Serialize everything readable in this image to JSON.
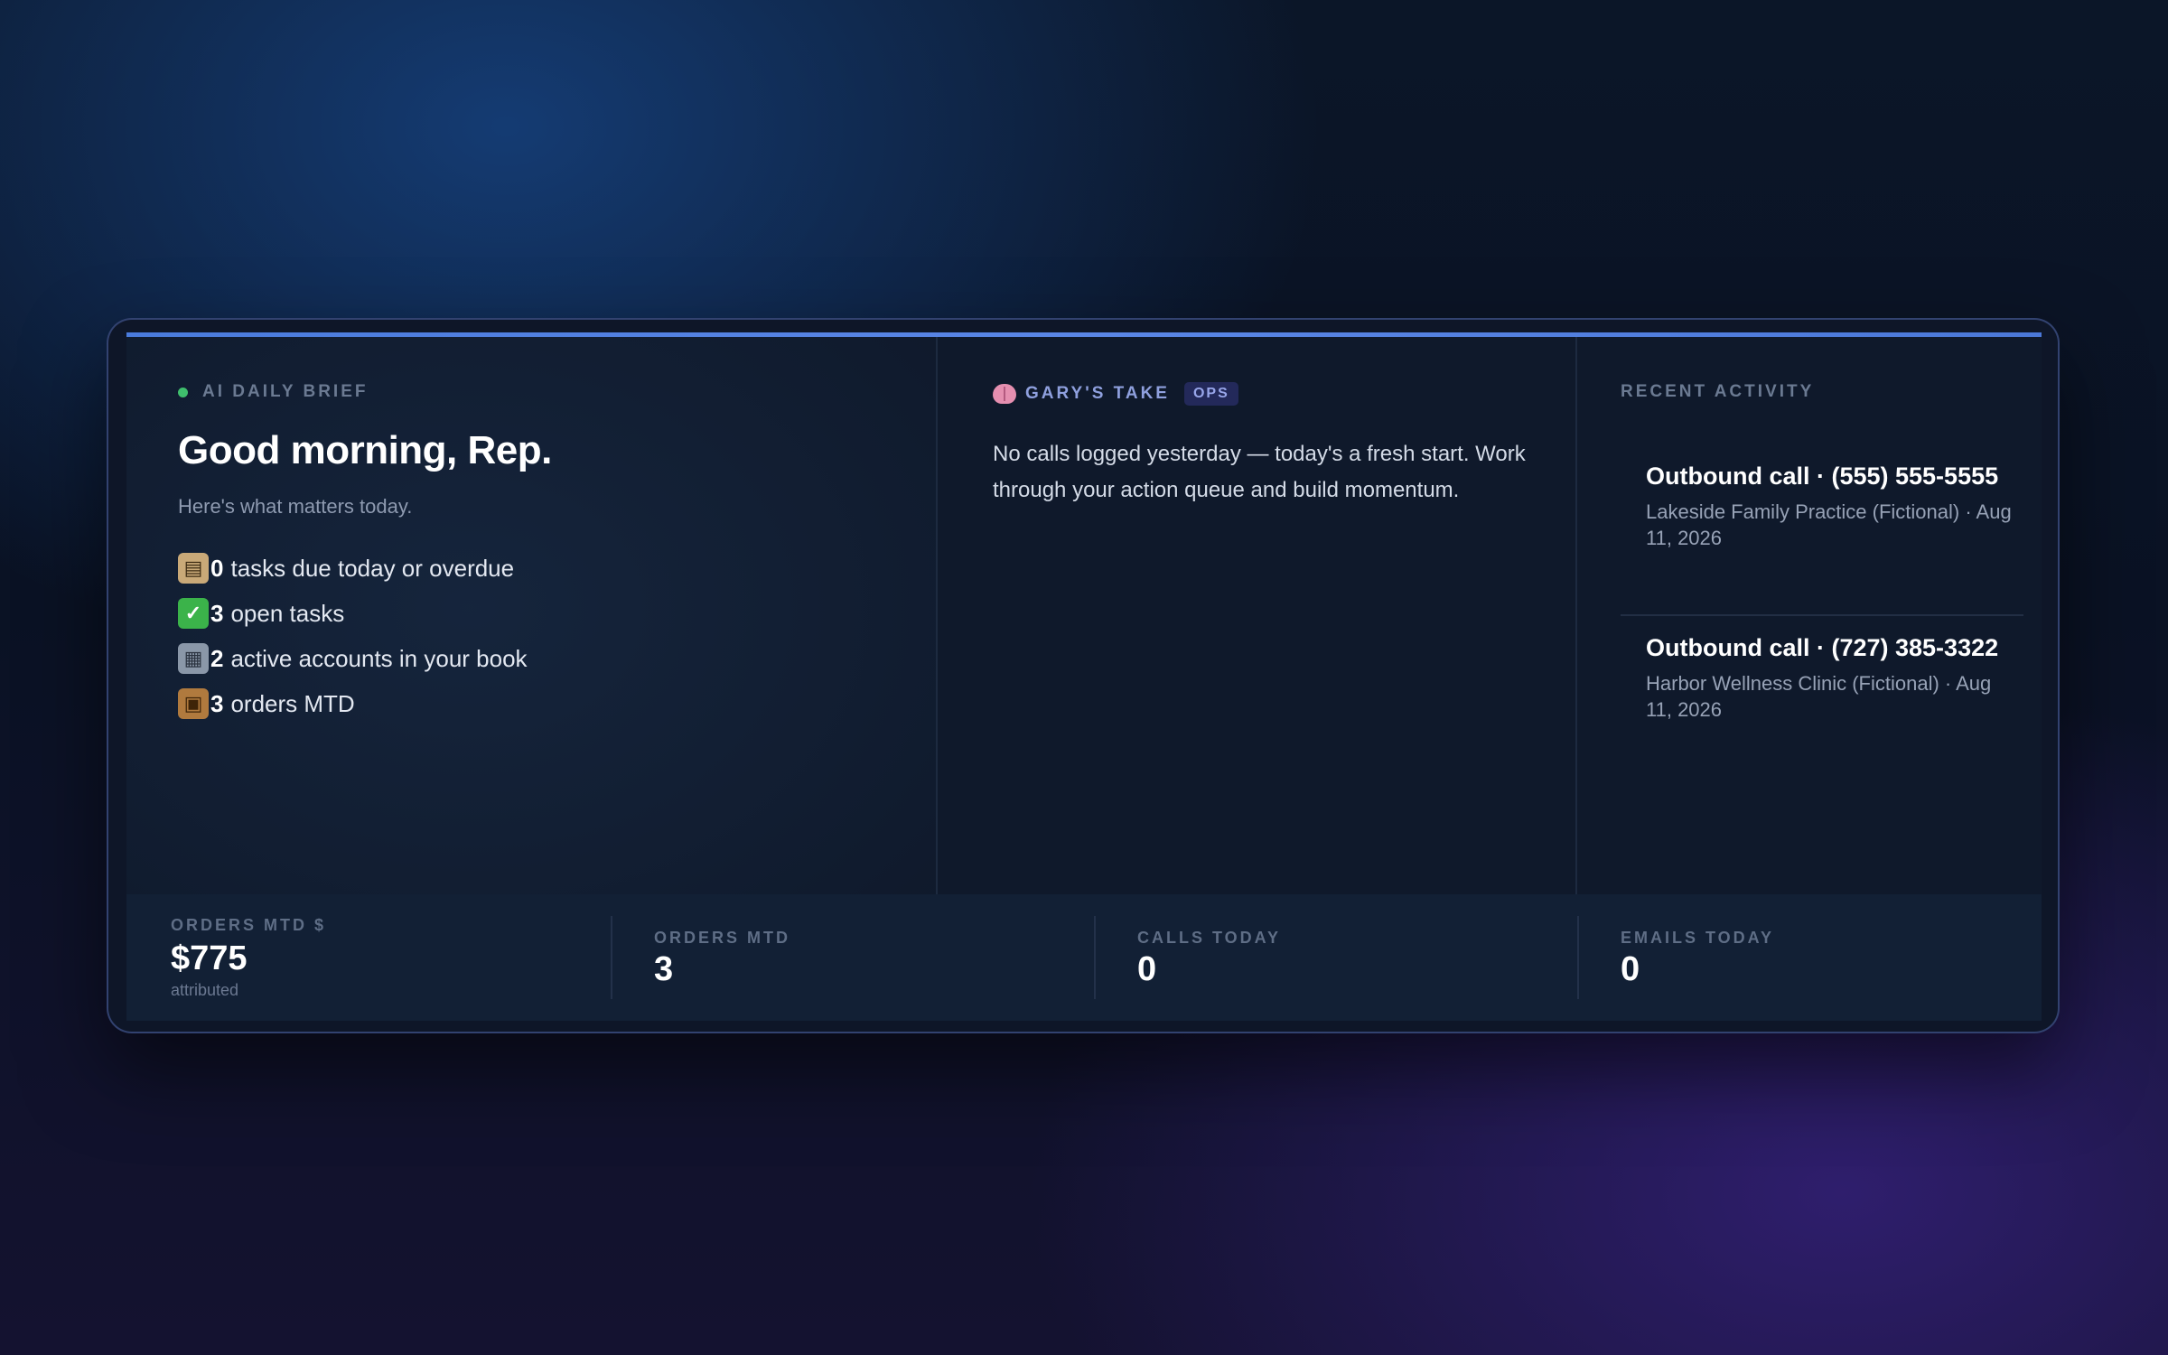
{
  "brief": {
    "eyebrow": "AI DAILY BRIEF",
    "greeting": "Good morning, Rep.",
    "subtitle": "Here's what matters today.",
    "items": [
      {
        "icon": "clipboard-icon",
        "count": "0",
        "text": "tasks due today or overdue"
      },
      {
        "icon": "check-icon",
        "count": "3",
        "text": "open tasks"
      },
      {
        "icon": "building-icon",
        "count": "2",
        "text": "active accounts in your book"
      },
      {
        "icon": "package-icon",
        "count": "3",
        "text": "orders MTD"
      }
    ]
  },
  "take": {
    "eyebrow": "GARY'S TAKE",
    "badge": "OPS",
    "text": "No calls logged yesterday — today's a fresh start. Work through your action queue and build momentum."
  },
  "activity": {
    "eyebrow": "RECENT ACTIVITY",
    "items": [
      {
        "title": "Outbound call · (555) 555-5555",
        "meta": "Lakeside Family Practice (Fictional) · Aug 11, 2026"
      },
      {
        "title": "Outbound call · (727) 385-3322",
        "meta": "Harbor Wellness Clinic (Fictional) · Aug 11, 2026"
      }
    ]
  },
  "stats": [
    {
      "label": "ORDERS MTD $",
      "value": "$775",
      "sub": "attributed"
    },
    {
      "label": "ORDERS MTD",
      "value": "3"
    },
    {
      "label": "CALLS TODAY",
      "value": "0"
    },
    {
      "label": "EMAILS TODAY",
      "value": "0"
    }
  ],
  "colors": {
    "accent": "#4a7bdc",
    "status_dot": "#3fbf6d",
    "badge_bg": "#23295a",
    "badge_text": "#98a6ea"
  }
}
